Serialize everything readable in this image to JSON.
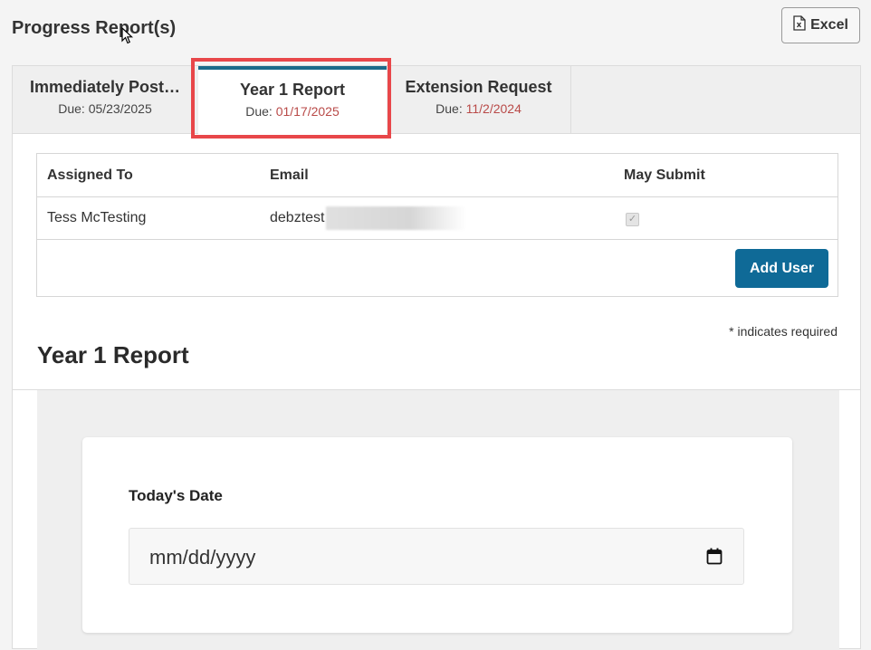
{
  "header": {
    "title": "Progress Report(s)",
    "excel_label": "Excel"
  },
  "tabs": [
    {
      "name": "Immediately Post…",
      "due_label": "Due:",
      "due_date": "05/23/2025",
      "active": false
    },
    {
      "name": "Year 1 Report",
      "due_label": "Due:",
      "due_date": "01/17/2025",
      "active": true,
      "due_color": "#b94a48"
    },
    {
      "name": "Extension Request",
      "due_label": "Due:",
      "due_date": "11/2/2024",
      "active": false,
      "due_color": "#b94a48"
    }
  ],
  "users_table": {
    "headers": [
      "Assigned To",
      "Email",
      "May Submit"
    ],
    "rows": [
      {
        "assigned_to": "Tess McTesting",
        "email": "debztest",
        "may_submit": true
      }
    ],
    "add_user_label": "Add User"
  },
  "form": {
    "required_note": "* indicates required",
    "section_title": "Year 1 Report",
    "date_field_label": "Today's Date",
    "date_placeholder": "mm/dd/yyyy"
  },
  "colors": {
    "accent": "#0f6a97",
    "active_tab_border": "#1b6a8a",
    "highlight": "#e8474a",
    "overdue_date": "#b94a48"
  },
  "icons": {
    "excel": "excel-file-icon",
    "calendar": "calendar-icon",
    "cursor": "mouse-pointer-icon"
  }
}
